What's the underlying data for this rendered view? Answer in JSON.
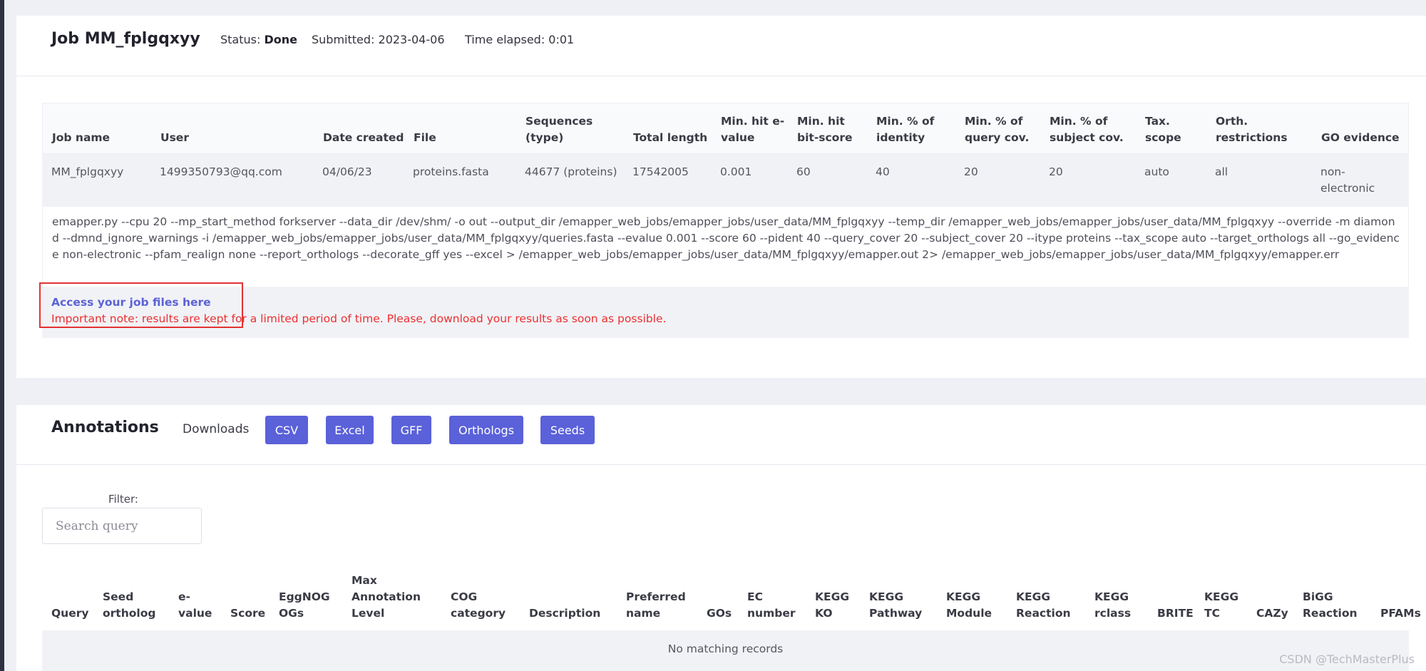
{
  "job": {
    "title": "Job MM_fplgqxyy",
    "status_label": "Status:",
    "status_value": "Done",
    "submitted": "Submitted: 2023-04-06",
    "elapsed": "Time elapsed: 0:01"
  },
  "job_table": {
    "headers": [
      "Job name",
      "User",
      "Date created",
      "File",
      "Sequences (type)",
      "Total length",
      "Min. hit e-value",
      "Min. hit bit-score",
      "Min. % of identity",
      "Min. % of query cov.",
      "Min. % of subject cov.",
      "Tax. scope",
      "Orth. restrictions",
      "GO evidence"
    ],
    "row": [
      "MM_fplgqxyy",
      "1499350793@qq.com",
      "04/06/23",
      "proteins.fasta",
      "44677 (proteins)",
      "17542005",
      "0.001",
      "60",
      "40",
      "20",
      "20",
      "auto",
      "all",
      "non-electronic"
    ],
    "command": "emapper.py --cpu 20 --mp_start_method forkserver --data_dir /dev/shm/ -o out --output_dir /emapper_web_jobs/emapper_jobs/user_data/MM_fplgqxyy --temp_dir /emapper_web_jobs/emapper_jobs/user_data/MM_fplgqxyy --override -m diamond --dmnd_ignore_warnings -i /emapper_web_jobs/emapper_jobs/user_data/MM_fplgqxyy/queries.fasta --evalue 0.001 --score 60 --pident 40 --query_cover 20 --subject_cover 20 --itype proteins --tax_scope auto --target_orthologs all --go_evidence non-electronic --pfam_realign none --report_orthologs --decorate_gff yes --excel > /emapper_web_jobs/emapper_jobs/user_data/MM_fplgqxyy/emapper.out 2> /emapper_web_jobs/emapper_jobs/user_data/MM_fplgqxyy/emapper.err",
    "access_link": "Access your job files here",
    "note": "Important note: results are kept for a limited period of time. Please, download your results as soon as possible."
  },
  "annotations": {
    "title": "Annotations",
    "downloads_label": "Downloads",
    "buttons": [
      "CSV",
      "Excel",
      "GFF",
      "Orthologs",
      "Seeds"
    ],
    "filter_label": "Filter:",
    "search_placeholder": "Search query",
    "search_value": "",
    "headers": [
      "Query",
      "Seed ortholog",
      "e-value",
      "Score",
      "EggNOG OGs",
      "Max Annotation Level",
      "COG category",
      "Description",
      "Preferred name",
      "GOs",
      "EC number",
      "KEGG KO",
      "KEGG Pathway",
      "KEGG Module",
      "KEGG Reaction",
      "KEGG rclass",
      "BRITE",
      "KEGG TC",
      "CAZy",
      "BiGG Reaction",
      "PFAMs"
    ],
    "empty_message": "No matching records"
  },
  "watermark": "CSDN @TechMasterPlus",
  "colors": {
    "accent": "#5a61d9",
    "link": "#5b62d6",
    "warning": "#ec2f2f",
    "highlight_box": "#e23232",
    "background": "#eef0f5",
    "sidebar": "#2e3142"
  }
}
